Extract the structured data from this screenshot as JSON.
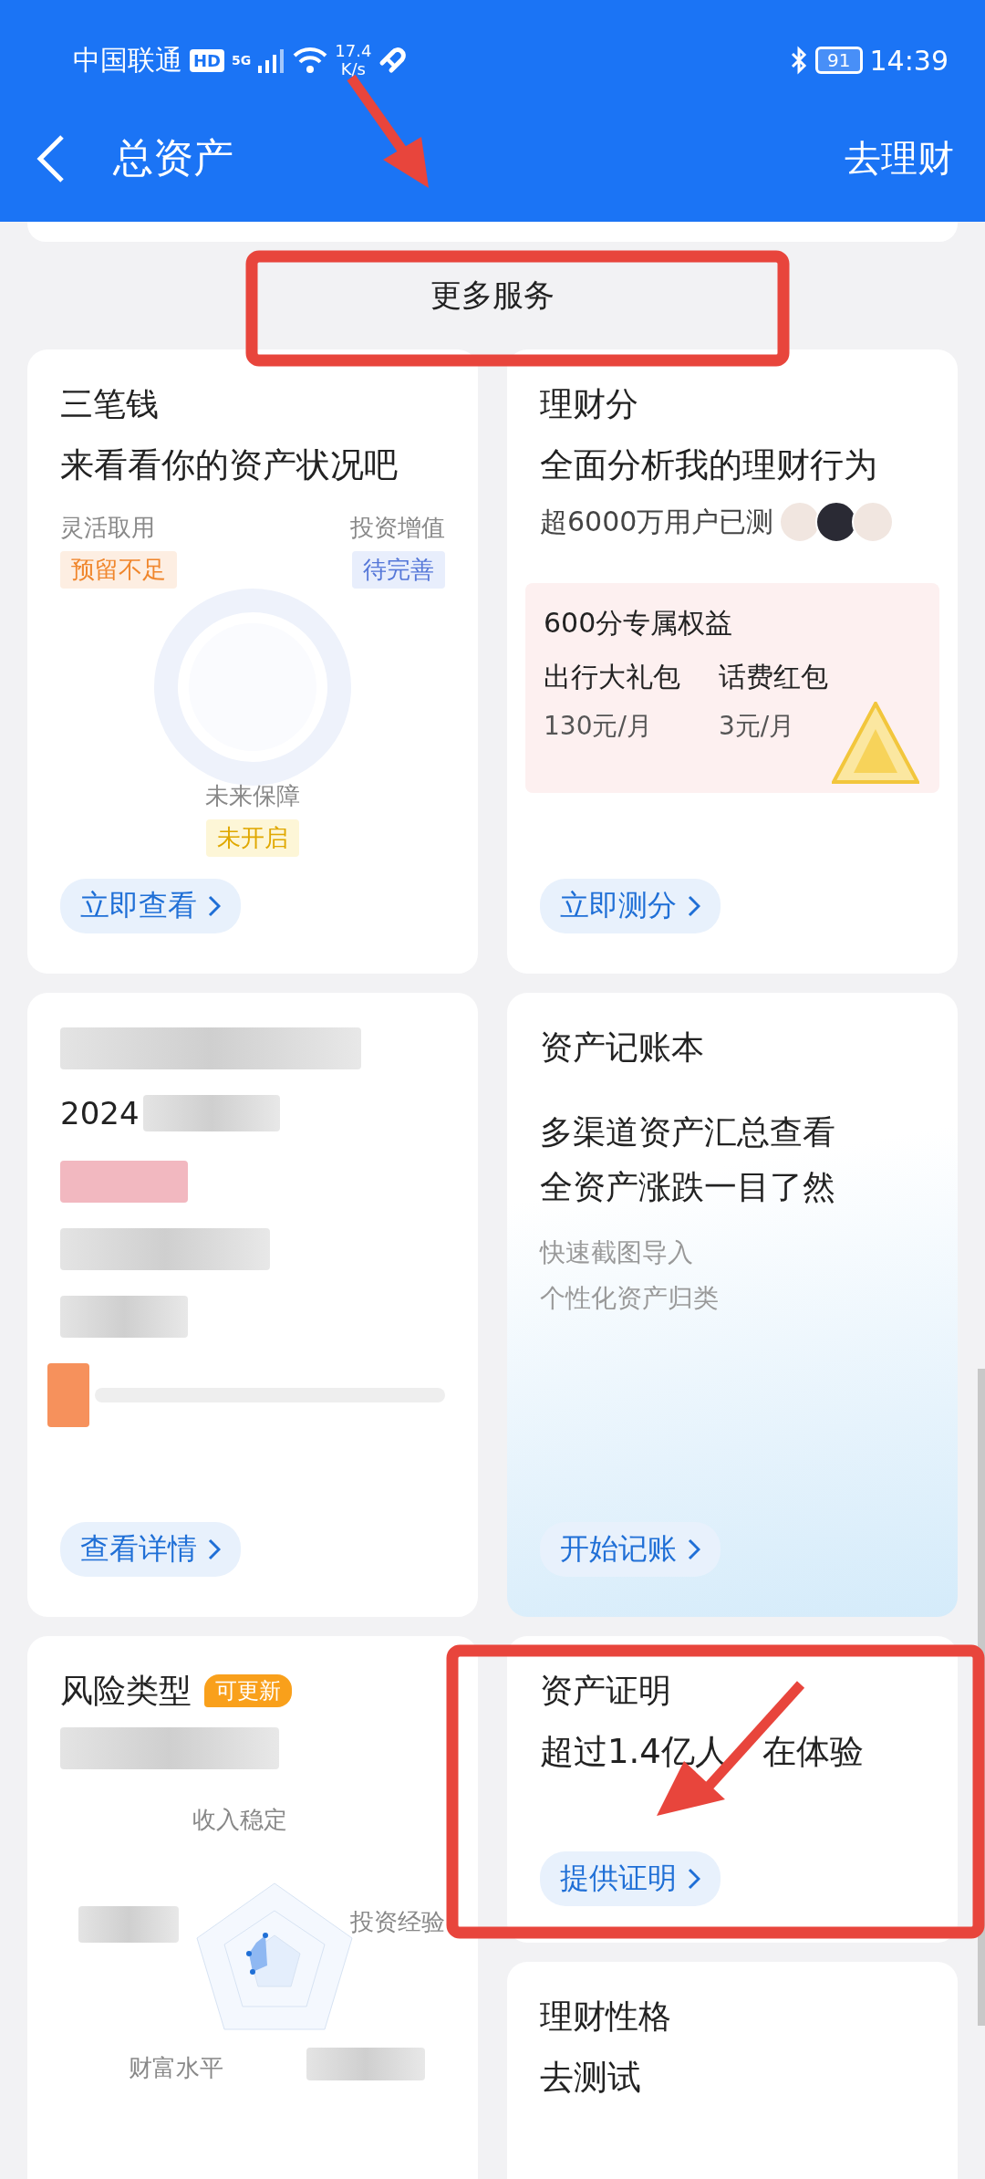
{
  "status_bar": {
    "carrier": "中国联通",
    "hd_badge": "HD",
    "network": "5G",
    "speed_value": "17.4",
    "speed_unit": "K/s",
    "battery": "91",
    "time": "14:39"
  },
  "header": {
    "title": "总资产",
    "action": "去理财"
  },
  "section_title": "更多服务",
  "three_funds": {
    "title": "三笔钱",
    "subtitle": "来看看你的资产状况吧",
    "left": {
      "label": "灵活取用",
      "status": "预留不足",
      "kind": "warning"
    },
    "right": {
      "label": "投资增值",
      "status": "待完善",
      "kind": "pending"
    },
    "bottom": {
      "label": "未来保障",
      "status": "未开启",
      "kind": "off"
    },
    "button": "立即查看"
  },
  "score": {
    "title": "理财分",
    "subtitle": "全面分析我的理财行为",
    "users": "超6000万用户已测",
    "perk_title": "600分专属权益",
    "perks": [
      {
        "name": "出行大礼包",
        "price": "130元/月"
      },
      {
        "name": "话费红包",
        "price": "3元/月"
      }
    ],
    "button": "立即测分"
  },
  "report": {
    "year": "2024",
    "button": "查看详情"
  },
  "ledger": {
    "title": "资产记账本",
    "lines": [
      "多渠道资产汇总查看",
      "全资产涨跌一目了然"
    ],
    "notes": [
      "快速截图导入",
      "个性化资产归类"
    ],
    "button": "开始记账"
  },
  "risk": {
    "title": "风险类型",
    "badge": "可更新",
    "axes": [
      "收入稳定",
      "投资经验",
      "财富水平"
    ]
  },
  "proof": {
    "title": "资产证明",
    "subtitle_parts": [
      "超过1.4亿人",
      "在体验"
    ],
    "button": "提供证明"
  },
  "personality": {
    "title": "理财性格",
    "subtitle": "去测试"
  }
}
